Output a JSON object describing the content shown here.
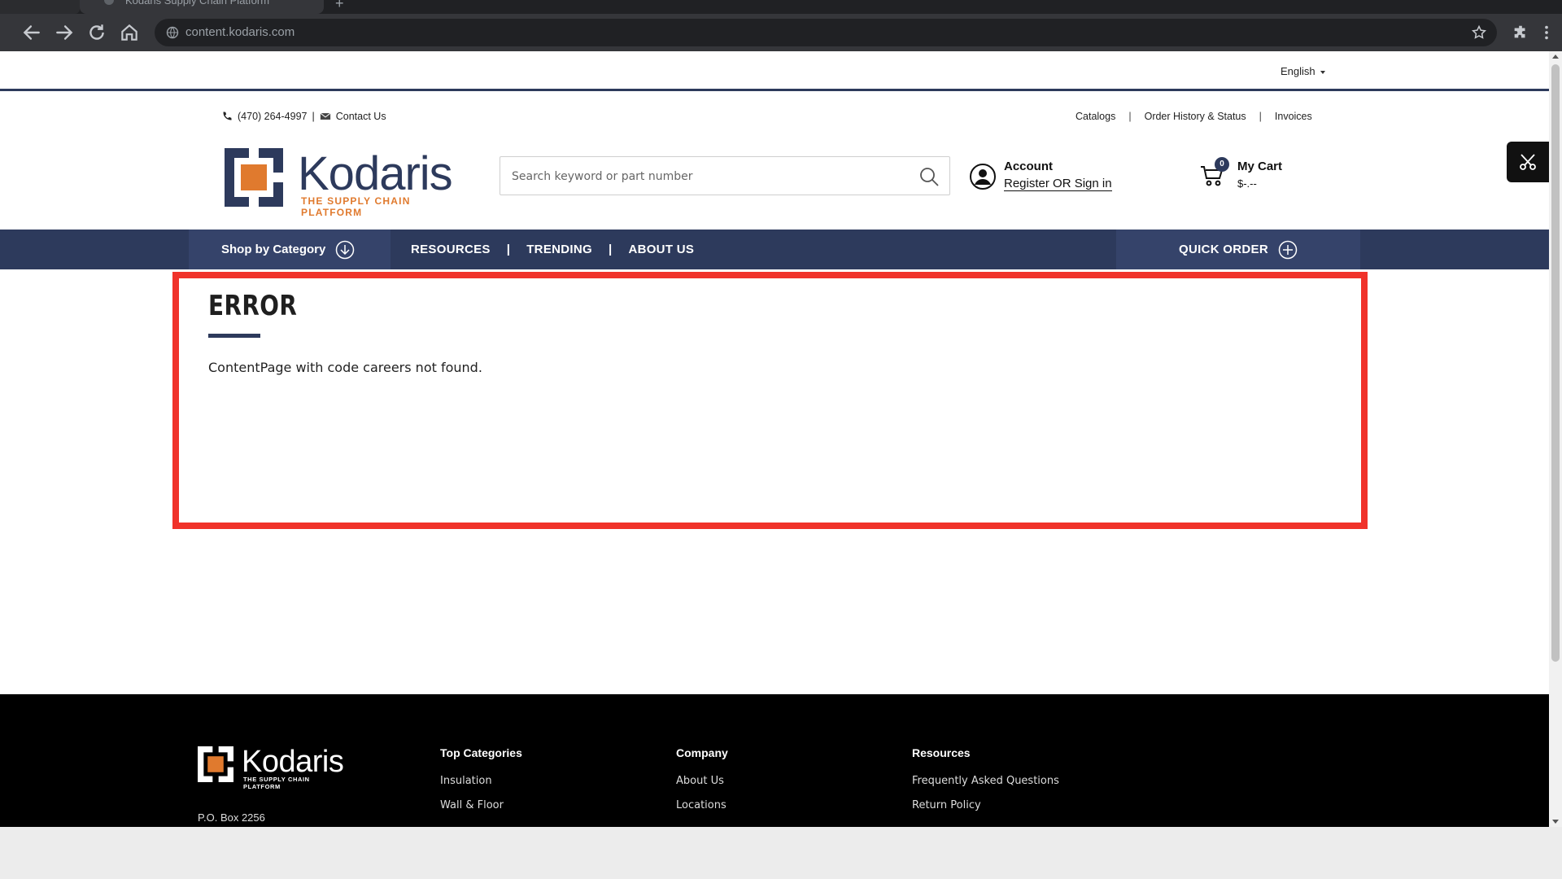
{
  "browser": {
    "tab_title": "Kodaris Supply Chain Platform",
    "url": "content.kodaris.com",
    "new_tab_symbol": "+"
  },
  "header": {
    "language": "English",
    "phone": "(470) 264-4997",
    "phone_sep": "|",
    "contact": "Contact Us",
    "util_links": [
      "Catalogs",
      "Order History & Status",
      "Invoices"
    ],
    "util_sep": "|",
    "logo_word": "Kodaris",
    "logo_tagline": "THE SUPPLY CHAIN PLATFORM",
    "search_placeholder": "Search keyword or part number",
    "account_title": "Account",
    "account_link": "Register OR Sign in",
    "cart_count": "0",
    "cart_title": "My Cart",
    "cart_total": "$-.--"
  },
  "nav": {
    "shop_by_category": "Shop by Category",
    "links": [
      "RESOURCES",
      "TRENDING",
      "ABOUT US"
    ],
    "sep": "|",
    "quick_order": "QUICK ORDER"
  },
  "error": {
    "title": "ERROR",
    "message": "ContentPage with code careers not found.",
    "highlight_color": "#f0322a"
  },
  "footer": {
    "logo_word": "Kodaris",
    "logo_tagline": "THE SUPPLY CHAIN PLATFORM",
    "address": "P.O. Box 2256",
    "columns": [
      {
        "title": "Top Categories",
        "items": [
          "Insulation",
          "Wall & Floor"
        ]
      },
      {
        "title": "Company",
        "items": [
          "About Us",
          "Locations"
        ]
      },
      {
        "title": "Resources",
        "items": [
          "Frequently Asked Questions",
          "Return Policy"
        ]
      }
    ]
  },
  "colors": {
    "brand_navy": "#2d3a5c",
    "brand_orange": "#e07a2e",
    "highlight_red": "#f0322a"
  }
}
